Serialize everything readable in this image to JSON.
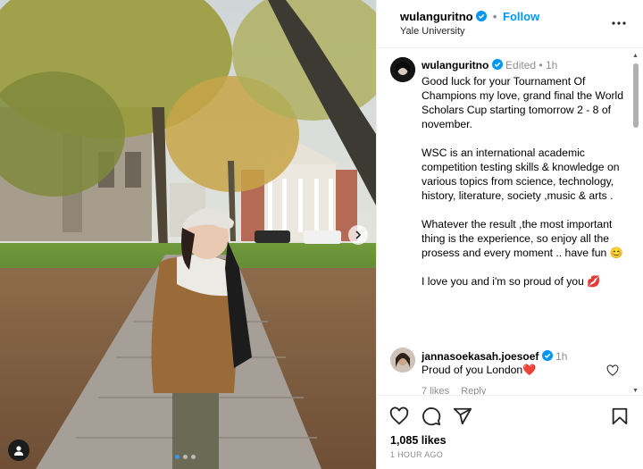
{
  "post": {
    "author": "wulanguritno",
    "follow_label": "Follow",
    "separator": "•",
    "location": "Yale University",
    "caption": {
      "author": "wulanguritno",
      "edited_label": "Edited",
      "separator": "•",
      "time": "1h",
      "text": "Good luck for your Tournament Of Champions my love, grand final the World Scholars Cup starting tomorrow 2 - 8 of november.\n\nWSC is an international academic competition testing skills & knowledge on various topics from science, technology, history, literature, society ,music & arts .\n\nWhatever the result ,the most important thing is the experience, so enjoy all the prosess and  every moment .. have fun 😊\n\nI love you and i'm so proud of you 💋"
    },
    "comment": {
      "author": "jannasoekasah.joesoef",
      "time": "1h",
      "text": "Proud of you London❤️",
      "likes": "7 likes",
      "reply_label": "Reply"
    },
    "likes_count": "1,085 likes",
    "posted": "1 HOUR AGO",
    "carousel": {
      "current": 1,
      "total": 3
    }
  },
  "icons": {
    "verified": "verified-badge-icon",
    "more": "more-options-icon",
    "like": "heart-icon",
    "comment": "comment-icon",
    "share": "share-icon",
    "save": "bookmark-icon",
    "next": "chevron-right-icon",
    "tag": "user-tag-icon"
  },
  "colors": {
    "accent": "#0095f6",
    "verified": "#0095f6",
    "muted": "#8e8e8e"
  }
}
